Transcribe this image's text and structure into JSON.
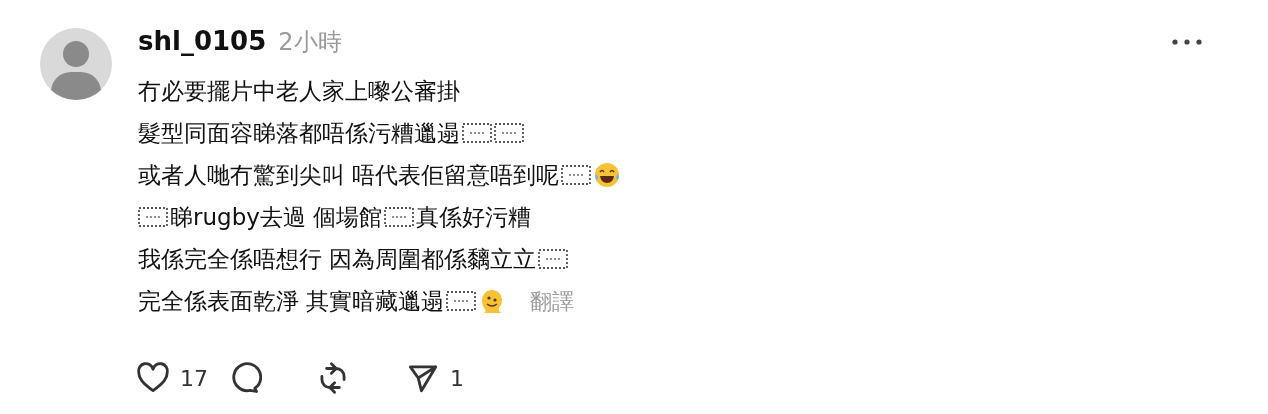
{
  "comment": {
    "username": "shl_0105",
    "time": "2小時",
    "lines": [
      {
        "parts": [
          {
            "kind": "text",
            "text": "冇必要擺片中老人家上嚟公審掛"
          }
        ]
      },
      {
        "parts": [
          {
            "kind": "text",
            "text": "髮型同面容睇落都唔係污糟邋遢"
          },
          {
            "kind": "object"
          },
          {
            "kind": "object"
          }
        ]
      },
      {
        "parts": [
          {
            "kind": "text",
            "text": "或者人哋冇驚到尖叫 唔代表佢留意唔到呢"
          },
          {
            "kind": "object"
          },
          {
            "kind": "laughing"
          }
        ]
      },
      {
        "parts": [
          {
            "kind": "object"
          },
          {
            "kind": "text",
            "text": "睇rugby去過 個場館"
          },
          {
            "kind": "object"
          },
          {
            "kind": "text",
            "text": "真係好污糟"
          }
        ]
      },
      {
        "parts": [
          {
            "kind": "text",
            "text": "我係完全係唔想行 因為周圍都係黐立立"
          },
          {
            "kind": "object"
          }
        ]
      },
      {
        "parts": [
          {
            "kind": "text",
            "text": "完全係表面乾淨 其實暗藏邋遢"
          },
          {
            "kind": "object"
          },
          {
            "kind": "melting"
          }
        ]
      }
    ],
    "translate": "翻譯",
    "actions": [
      {
        "kind": "like",
        "count": "17"
      },
      {
        "kind": "reply"
      },
      {
        "kind": "repost"
      },
      {
        "kind": "share",
        "count": "1"
      }
    ]
  }
}
